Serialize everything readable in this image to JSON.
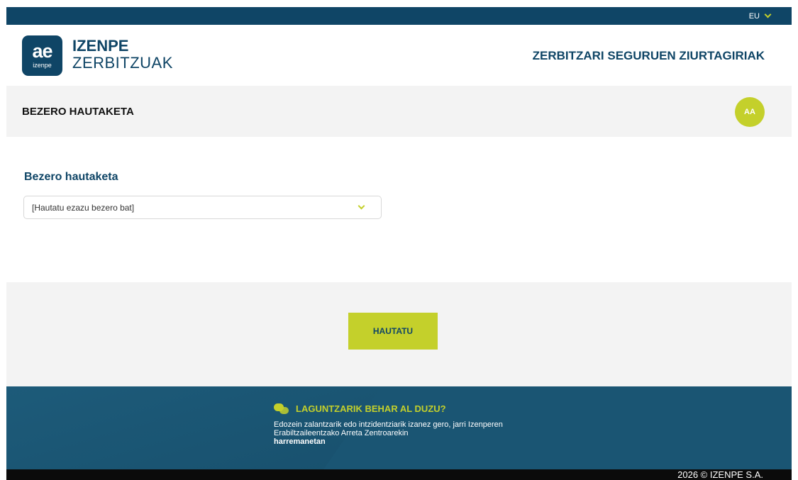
{
  "language": {
    "current": "EU"
  },
  "brand": {
    "logo_mark": "ae",
    "logo_sub": "izenpe",
    "name_line1": "IZENPE",
    "name_line2": "ZERBITZUAK"
  },
  "header": {
    "app_title": "ZERBITZARI SEGURUEN ZIURTAGIRIAK"
  },
  "subheader": {
    "page_title": "BEZERO HAUTAKETA",
    "avatar_initials": "AA"
  },
  "form": {
    "label": "Bezero hautaketa",
    "select_value": "[Hautatu ezazu bezero bat]"
  },
  "actions": {
    "submit_label": "HAUTATU"
  },
  "footer": {
    "help_title": "LAGUNTZARIK BEHAR AL DUZU?",
    "help_text": "Edozein zalantzarik edo intzidentziarik izanez gero, jarri Izenperen Erabiltzaileentzako Arreta Zentroarekin",
    "help_link": "harremanetan",
    "copyright": "2026 © IZENPE S.A."
  },
  "icons": {
    "lang_dropdown": "chevron-down-icon",
    "select_dropdown": "chevron-down-icon",
    "help": "chat-bubbles-icon"
  },
  "colors": {
    "primary": "#0f4566",
    "accent": "#c4d02b",
    "band": "#f3f3f3",
    "footer": "#1a5573"
  }
}
